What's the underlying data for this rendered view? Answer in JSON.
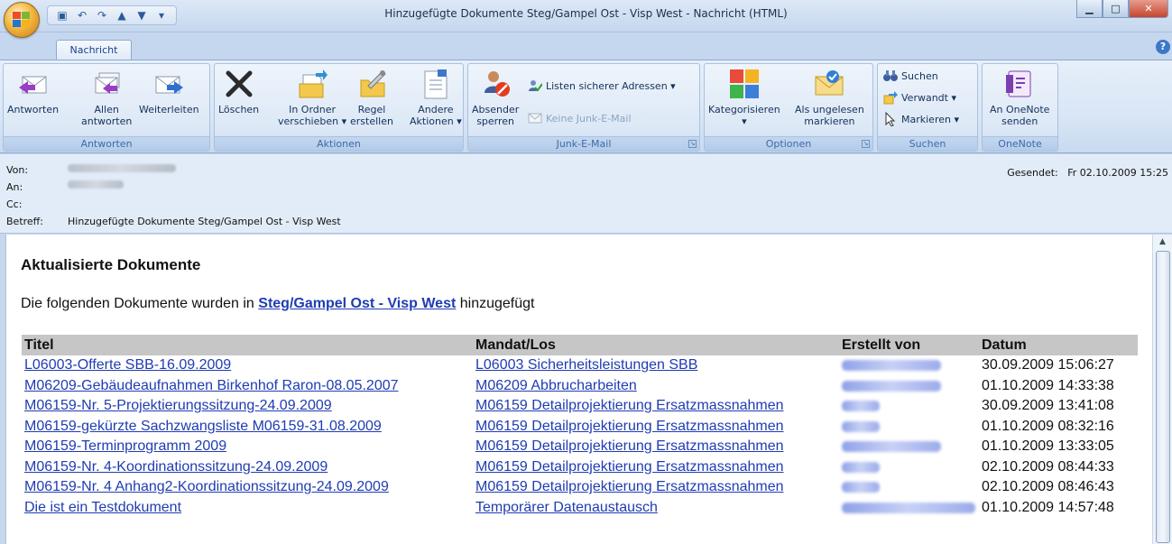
{
  "window": {
    "title": "Hinzugefügte Dokumente Steg/Gampel Ost - Visp West - Nachricht (HTML)"
  },
  "tabs": [
    {
      "label": "Nachricht"
    }
  ],
  "ribbon": {
    "groups": {
      "antworten": {
        "label": "Antworten",
        "reply": "Antworten",
        "reply_all_1": "Allen",
        "reply_all_2": "antworten",
        "forward": "Weiterleiten"
      },
      "aktionen": {
        "label": "Aktionen",
        "delete": "Löschen",
        "move_1": "In Ordner",
        "move_2": "verschieben ▾",
        "rule_1": "Regel",
        "rule_2": "erstellen",
        "other_1": "Andere",
        "other_2": "Aktionen ▾"
      },
      "junk": {
        "label": "Junk-E-Mail",
        "block_1": "Absender",
        "block_2": "sperren",
        "safe_lists": "Listen sicherer Adressen ▾",
        "not_junk": "Keine Junk-E-Mail"
      },
      "optionen": {
        "label": "Optionen",
        "categorize": "Kategorisieren",
        "categorize_arrow": "▾",
        "mark_unread_1": "Als ungelesen",
        "mark_unread_2": "markieren"
      },
      "suchen": {
        "label": "Suchen",
        "find": "Suchen",
        "related": "Verwandt ▾",
        "select": "Markieren ▾"
      },
      "onenote": {
        "label": "OneNote",
        "send_1": "An OneNote",
        "send_2": "senden"
      }
    }
  },
  "header": {
    "from_label": "Von:",
    "to_label": "An:",
    "cc_label": "Cc:",
    "subject_label": "Betreff:",
    "subject": "Hinzugefügte Dokumente Steg/Gampel Ost - Visp West",
    "sent_label": "Gesendet:",
    "sent_value": "Fr 02.10.2009 15:25"
  },
  "body": {
    "title": "Aktualisierte Dokumente",
    "intro_before": "Die folgenden Dokumente wurden in ",
    "intro_link": "Steg/Gampel Ost - Visp West",
    "intro_after": " hinzugefügt",
    "table": {
      "headers": [
        "Titel",
        "Mandat/Los",
        "Erstellt von",
        "Datum"
      ],
      "rows": [
        {
          "titel": "L06003-Offerte SBB-16.09.2009",
          "mandat": "L06003 Sicherheitsleistungen SBB",
          "datum": "30.09.2009 15:06:27"
        },
        {
          "titel": "M06209-Gebäudeaufnahmen Birkenhof Raron-08.05.2007",
          "mandat": "M06209 Abbrucharbeiten",
          "datum": "01.10.2009 14:33:38"
        },
        {
          "titel": "M06159-Nr. 5-Projektierungssitzung-24.09.2009",
          "mandat": "M06159 Detailprojektierung Ersatzmassnahmen",
          "datum": "30.09.2009 13:41:08"
        },
        {
          "titel": "M06159-gekürzte Sachzwangsliste M06159-31.08.2009",
          "mandat": "M06159 Detailprojektierung Ersatzmassnahmen",
          "datum": "01.10.2009 08:32:16"
        },
        {
          "titel": "M06159-Terminprogramm 2009",
          "mandat": "M06159 Detailprojektierung Ersatzmassnahmen",
          "datum": "01.10.2009 13:33:05"
        },
        {
          "titel": "M06159-Nr. 4-Koordinationssitzung-24.09.2009",
          "mandat": "M06159 Detailprojektierung Ersatzmassnahmen",
          "datum": "02.10.2009 08:44:33"
        },
        {
          "titel": "M06159-Nr. 4 Anhang2-Koordinationssitzung-24.09.2009",
          "mandat": "M06159 Detailprojektierung Ersatzmassnahmen",
          "datum": "02.10.2009 08:46:43"
        },
        {
          "titel": "Die ist ein Testdokument",
          "mandat": "Temporärer Datenaustausch",
          "datum": "01.10.2009 14:57:48"
        }
      ]
    }
  },
  "colors": {
    "link": "#1f3cb3",
    "ribbon_label": "#3e6aaa",
    "table_header_bg": "#c6c6c6"
  }
}
